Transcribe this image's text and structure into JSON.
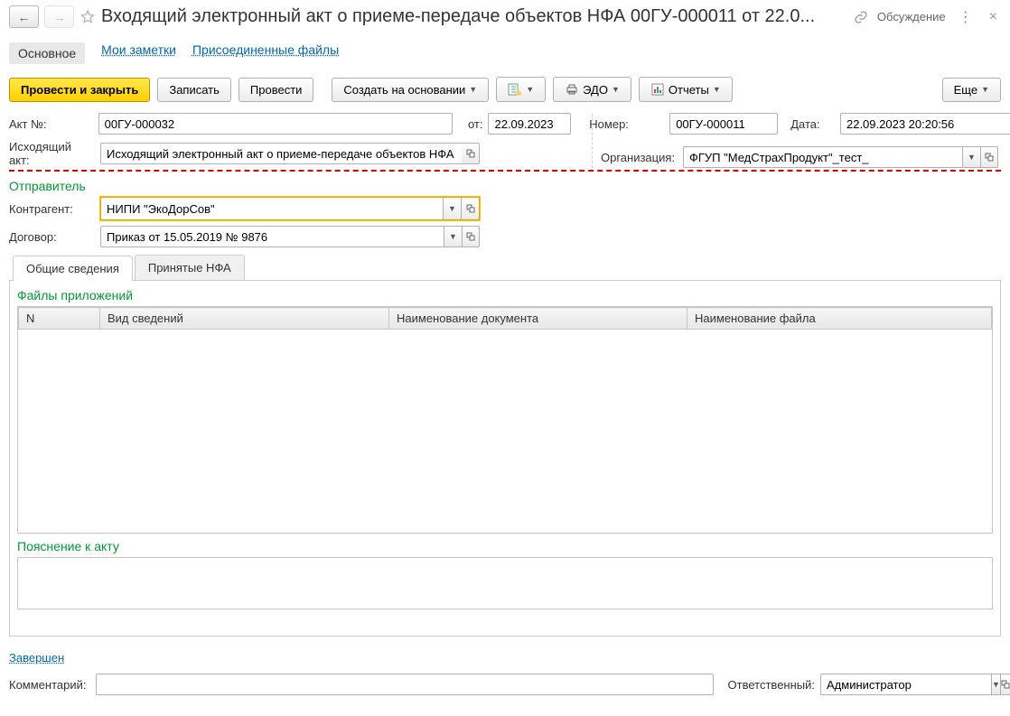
{
  "header": {
    "title": "Входящий электронный акт о приеме-передаче объектов НФА 00ГУ-000011 от 22.0...",
    "discussion": "Обсуждение"
  },
  "navTabs": {
    "main": "Основное",
    "notes": "Мои заметки",
    "attachments": "Присоединенные файлы"
  },
  "toolbar": {
    "postClose": "Провести и закрыть",
    "record": "Записать",
    "post": "Провести",
    "createOn": "Создать на основании",
    "edo": "ЭДО",
    "reports": "Отчеты",
    "more": "Еще"
  },
  "form": {
    "actNoLabel": "Акт №:",
    "actNo": "00ГУ-000032",
    "fromLabel": "от:",
    "fromDate": "22.09.2023",
    "numberLabel": "Номер:",
    "number": "00ГУ-000011",
    "dateLabel": "Дата:",
    "date": "22.09.2023 20:20:56",
    "outActLabel": "Исходящий акт:",
    "outAct": "Исходящий электронный акт о приеме-передаче объектов НФА",
    "orgLabel": "Организация:",
    "org": "ФГУП \"МедСтрахПродукт\"_тест_",
    "senderTitle": "Отправитель",
    "counterpartyLabel": "Контрагент:",
    "counterparty": "НИПИ \"ЭкоДорСов\"",
    "contractLabel": "Договор:",
    "contract": "Приказ от 15.05.2019 № 9876"
  },
  "tabs": {
    "general": "Общие сведения",
    "accepted": "Принятые НФА"
  },
  "attachments": {
    "title": "Файлы приложений",
    "colN": "N",
    "colType": "Вид сведений",
    "colDocName": "Наименование документа",
    "colFileName": "Наименование файла"
  },
  "explanation": {
    "title": "Пояснение к акту"
  },
  "status": {
    "completed": "Завершен"
  },
  "footer": {
    "commentLabel": "Комментарий:",
    "comment": "",
    "responsibleLabel": "Ответственный:",
    "responsible": "Администратор"
  },
  "icons": {
    "arrowLeft": "←",
    "arrowRight": "→",
    "close": "×"
  }
}
